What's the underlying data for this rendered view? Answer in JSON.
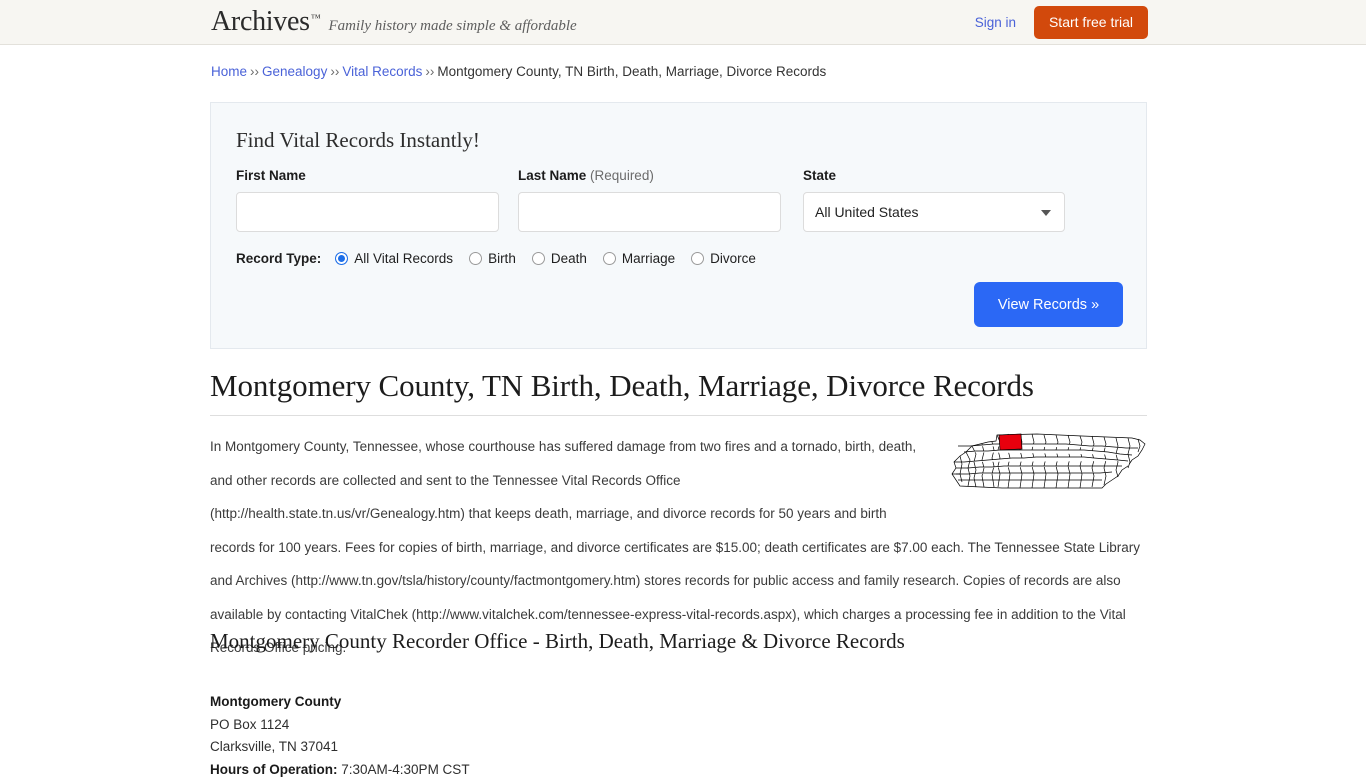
{
  "header": {
    "logo": "Archives",
    "logo_tm": "™",
    "tagline": "Family history made simple & affordable",
    "signin_label": "Sign in",
    "trial_label": "Start free trial",
    "trial_color": "#d2490c",
    "link_color": "#4a62d8"
  },
  "breadcrumb": {
    "items": [
      {
        "label": "Home",
        "link": true
      },
      {
        "label": "Genealogy",
        "link": true
      },
      {
        "label": "Vital Records",
        "link": true
      },
      {
        "label": "Montgomery County, TN Birth, Death, Marriage, Divorce Records",
        "link": false
      }
    ],
    "separator": "››"
  },
  "search_panel": {
    "title": "Find Vital Records Instantly!",
    "first_name": {
      "label": "First Name",
      "value": "",
      "placeholder": ""
    },
    "last_name": {
      "label": "Last Name",
      "required_note": "(Required)",
      "value": "",
      "placeholder": ""
    },
    "state": {
      "label": "State",
      "selected": "All United States"
    },
    "record_type": {
      "label": "Record Type:",
      "options": [
        {
          "label": "All Vital Records",
          "checked": true
        },
        {
          "label": "Birth",
          "checked": false
        },
        {
          "label": "Death",
          "checked": false
        },
        {
          "label": "Marriage",
          "checked": false
        },
        {
          "label": "Divorce",
          "checked": false
        }
      ]
    },
    "submit_label": "View Records »",
    "submit_color": "#2b68f5"
  },
  "main": {
    "page_title": "Montgomery County, TN Birth, Death, Marriage, Divorce Records",
    "body_text": "In Montgomery County, Tennessee, whose courthouse has suffered damage from two fires and a tornado, birth, death, and other records are collected and sent to the Tennessee Vital Records Office (http://health.state.tn.us/vr/Genealogy.htm) that keeps death, marriage, and divorce records for 50 years and birth records for 100 years. Fees for copies of birth, marriage, and divorce certificates are $15.00; death certificates are $7.00 each. The Tennessee State Library and Archives (http://www.tn.gov/tsla/history/county/factmontgomery.htm) stores records for public access and family research. Copies of records are also available by contacting VitalChek (http://www.vitalchek.com/tennessee-express-vital-records.aspx), which charges a processing fee in addition to the Vital Records Office pricing.",
    "map": {
      "name": "tennessee-county-map",
      "highlight_color": "#e8000d",
      "highlighted_county": "Montgomery County"
    },
    "section_title": "Montgomery County Recorder Office - Birth, Death, Marriage & Divorce Records",
    "address": {
      "name": "Montgomery County",
      "line1": "PO Box 1124",
      "line2": "Clarksville, TN 37041",
      "hours_label": "Hours of Operation:",
      "hours_value": "7:30AM-4:30PM CST"
    }
  }
}
